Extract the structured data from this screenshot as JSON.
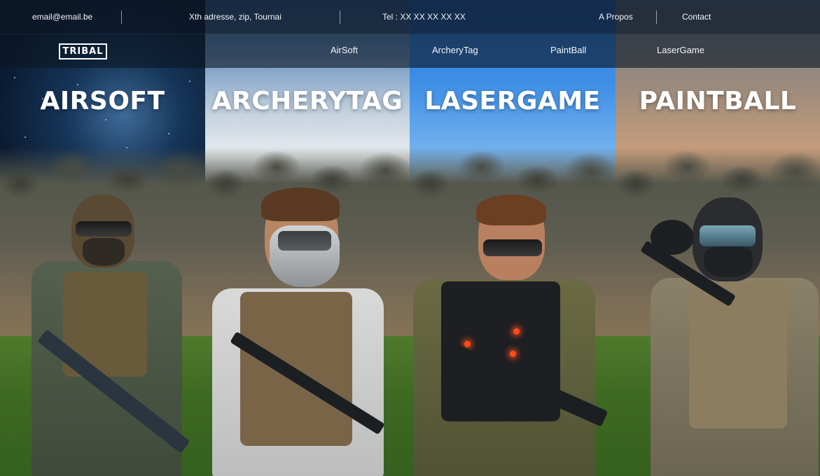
{
  "topbar": {
    "email": "email@email.be",
    "address": "Xth adresse, zip, Tournai",
    "phone": "Tel : XX XX XX XX XX",
    "about": "A Propos",
    "contact": "Contact"
  },
  "navbar": {
    "logo": "TRIBAL",
    "links": [
      "AirSoft",
      "ArcheryTag",
      "PaintBall",
      "LaserGame"
    ]
  },
  "panels": [
    {
      "title": "AIRSOFT"
    },
    {
      "title": "ARCHERYTAG"
    },
    {
      "title": "LASERGAME"
    },
    {
      "title": "PAINTBALL"
    }
  ],
  "colors": {
    "header_bg": "#0c1624",
    "text": "#ffffff",
    "grass": "#3f6a22"
  }
}
